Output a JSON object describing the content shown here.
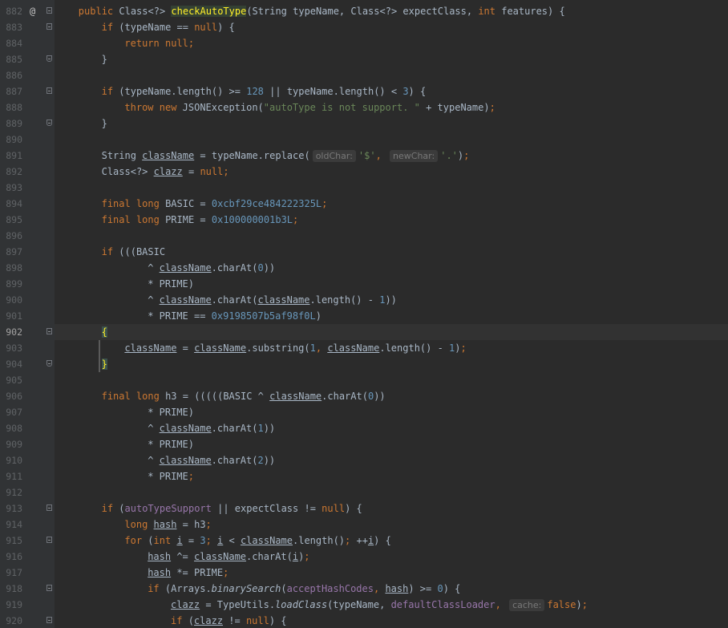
{
  "editor": {
    "current_line_number": "902",
    "lines": [
      {
        "n": "882",
        "icon": "@",
        "fold": "start",
        "indent": 1,
        "tokens": [
          {
            "t": "public ",
            "c": "kw"
          },
          {
            "t": "Class<?> "
          },
          {
            "t": "checkAutoType",
            "c": "hl-match"
          },
          {
            "t": "(String typeName, Class<?> expectClass, "
          },
          {
            "t": "int ",
            "c": "kw"
          },
          {
            "t": "features) {"
          }
        ]
      },
      {
        "n": "883",
        "fold": "start",
        "indent": 2,
        "tokens": [
          {
            "t": "if ",
            "c": "kw"
          },
          {
            "t": "(typeName == "
          },
          {
            "t": "null",
            "c": "kw"
          },
          {
            "t": ") {"
          }
        ]
      },
      {
        "n": "884",
        "indent": 3,
        "tokens": [
          {
            "t": "return null",
            "c": "kw"
          },
          {
            "t": ";",
            "c": "kw"
          }
        ]
      },
      {
        "n": "885",
        "fold": "end",
        "indent": 2,
        "tokens": [
          {
            "t": "}"
          }
        ]
      },
      {
        "n": "886",
        "indent": 0,
        "tokens": []
      },
      {
        "n": "887",
        "fold": "start",
        "indent": 2,
        "tokens": [
          {
            "t": "if ",
            "c": "kw"
          },
          {
            "t": "(typeName.length() >= "
          },
          {
            "t": "128",
            "c": "num"
          },
          {
            "t": " || typeName.length() < "
          },
          {
            "t": "3",
            "c": "num"
          },
          {
            "t": ") {"
          }
        ]
      },
      {
        "n": "888",
        "indent": 3,
        "tokens": [
          {
            "t": "throw new ",
            "c": "kw"
          },
          {
            "t": "JSONException("
          },
          {
            "t": "\"autoType is not support. \"",
            "c": "str"
          },
          {
            "t": " + typeName)"
          },
          {
            "t": ";",
            "c": "kw"
          }
        ]
      },
      {
        "n": "889",
        "fold": "end",
        "indent": 2,
        "tokens": [
          {
            "t": "}"
          }
        ]
      },
      {
        "n": "890",
        "indent": 0,
        "tokens": []
      },
      {
        "n": "891",
        "indent": 2,
        "tokens": [
          {
            "t": "String "
          },
          {
            "t": "className",
            "c": "ul"
          },
          {
            "t": " = typeName.replace("
          },
          {
            "t": "oldChar:",
            "c": "hint"
          },
          {
            "t": "'$'",
            "c": "str"
          },
          {
            "t": ", ",
            "c": "kw"
          },
          {
            "t": "newChar:",
            "c": "hint"
          },
          {
            "t": "'.'",
            "c": "str"
          },
          {
            "t": ")"
          },
          {
            "t": ";",
            "c": "kw"
          }
        ]
      },
      {
        "n": "892",
        "indent": 2,
        "tokens": [
          {
            "t": "Class<?> "
          },
          {
            "t": "clazz",
            "c": "ul"
          },
          {
            "t": " = "
          },
          {
            "t": "null",
            "c": "kw"
          },
          {
            "t": ";",
            "c": "kw"
          }
        ]
      },
      {
        "n": "893",
        "indent": 0,
        "tokens": []
      },
      {
        "n": "894",
        "indent": 2,
        "tokens": [
          {
            "t": "final long ",
            "c": "kw"
          },
          {
            "t": "BASIC = "
          },
          {
            "t": "0xcbf29ce484222325L",
            "c": "num"
          },
          {
            "t": ";",
            "c": "kw"
          }
        ]
      },
      {
        "n": "895",
        "indent": 2,
        "tokens": [
          {
            "t": "final long ",
            "c": "kw"
          },
          {
            "t": "PRIME = "
          },
          {
            "t": "0x100000001b3L",
            "c": "num"
          },
          {
            "t": ";",
            "c": "kw"
          }
        ]
      },
      {
        "n": "896",
        "indent": 0,
        "tokens": []
      },
      {
        "n": "897",
        "indent": 2,
        "tokens": [
          {
            "t": "if ",
            "c": "kw"
          },
          {
            "t": "(((BASIC"
          }
        ]
      },
      {
        "n": "898",
        "indent": 4,
        "tokens": [
          {
            "t": "^ "
          },
          {
            "t": "className",
            "c": "ul"
          },
          {
            "t": ".charAt("
          },
          {
            "t": "0",
            "c": "num"
          },
          {
            "t": "))"
          }
        ]
      },
      {
        "n": "899",
        "indent": 4,
        "tokens": [
          {
            "t": "* PRIME)"
          }
        ]
      },
      {
        "n": "900",
        "indent": 4,
        "tokens": [
          {
            "t": "^ "
          },
          {
            "t": "className",
            "c": "ul"
          },
          {
            "t": ".charAt("
          },
          {
            "t": "className",
            "c": "ul"
          },
          {
            "t": ".length() - "
          },
          {
            "t": "1",
            "c": "num"
          },
          {
            "t": "))"
          }
        ]
      },
      {
        "n": "901",
        "indent": 4,
        "tokens": [
          {
            "t": "* PRIME == "
          },
          {
            "t": "0x9198507b5af98f0L",
            "c": "num"
          },
          {
            "t": ")"
          }
        ]
      },
      {
        "n": "902",
        "fold": "start",
        "indent": 2,
        "current": true,
        "tokens": [
          {
            "t": "{",
            "c": "brace-hl"
          }
        ]
      },
      {
        "n": "903",
        "indent": 3,
        "tokens": [
          {
            "t": "className",
            "c": "ul"
          },
          {
            "t": " = "
          },
          {
            "t": "className",
            "c": "ul"
          },
          {
            "t": ".substring("
          },
          {
            "t": "1",
            "c": "num"
          },
          {
            "t": ", ",
            "c": "kw"
          },
          {
            "t": "className",
            "c": "ul"
          },
          {
            "t": ".length() - "
          },
          {
            "t": "1",
            "c": "num"
          },
          {
            "t": ")"
          },
          {
            "t": ";",
            "c": "kw"
          }
        ]
      },
      {
        "n": "904",
        "fold": "end",
        "indent": 2,
        "tokens": [
          {
            "t": "}",
            "c": "brace-hl"
          }
        ]
      },
      {
        "n": "905",
        "indent": 0,
        "tokens": []
      },
      {
        "n": "906",
        "indent": 2,
        "tokens": [
          {
            "t": "final long ",
            "c": "kw"
          },
          {
            "t": "h3 = (((((BASIC ^ "
          },
          {
            "t": "className",
            "c": "ul"
          },
          {
            "t": ".charAt("
          },
          {
            "t": "0",
            "c": "num"
          },
          {
            "t": "))"
          }
        ]
      },
      {
        "n": "907",
        "indent": 4,
        "tokens": [
          {
            "t": "* PRIME)"
          }
        ]
      },
      {
        "n": "908",
        "indent": 4,
        "tokens": [
          {
            "t": "^ "
          },
          {
            "t": "className",
            "c": "ul"
          },
          {
            "t": ".charAt("
          },
          {
            "t": "1",
            "c": "num"
          },
          {
            "t": "))"
          }
        ]
      },
      {
        "n": "909",
        "indent": 4,
        "tokens": [
          {
            "t": "* PRIME)"
          }
        ]
      },
      {
        "n": "910",
        "indent": 4,
        "tokens": [
          {
            "t": "^ "
          },
          {
            "t": "className",
            "c": "ul"
          },
          {
            "t": ".charAt("
          },
          {
            "t": "2",
            "c": "num"
          },
          {
            "t": "))"
          }
        ]
      },
      {
        "n": "911",
        "indent": 4,
        "tokens": [
          {
            "t": "* PRIME"
          },
          {
            "t": ";",
            "c": "kw"
          }
        ]
      },
      {
        "n": "912",
        "indent": 0,
        "tokens": []
      },
      {
        "n": "913",
        "fold": "start",
        "indent": 2,
        "tokens": [
          {
            "t": "if ",
            "c": "kw"
          },
          {
            "t": "("
          },
          {
            "t": "autoTypeSupport",
            "c": "fld"
          },
          {
            "t": " || expectClass != "
          },
          {
            "t": "null",
            "c": "kw"
          },
          {
            "t": ") {"
          }
        ]
      },
      {
        "n": "914",
        "indent": 3,
        "tokens": [
          {
            "t": "long ",
            "c": "kw"
          },
          {
            "t": "hash",
            "c": "ul"
          },
          {
            "t": " = h3"
          },
          {
            "t": ";",
            "c": "kw"
          }
        ]
      },
      {
        "n": "915",
        "fold": "start",
        "indent": 3,
        "tokens": [
          {
            "t": "for ",
            "c": "kw"
          },
          {
            "t": "("
          },
          {
            "t": "int ",
            "c": "kw"
          },
          {
            "t": "i",
            "c": "ul"
          },
          {
            "t": " = "
          },
          {
            "t": "3",
            "c": "num"
          },
          {
            "t": "; ",
            "c": "kw"
          },
          {
            "t": "i",
            "c": "ul"
          },
          {
            "t": " < "
          },
          {
            "t": "className",
            "c": "ul"
          },
          {
            "t": ".length()"
          },
          {
            "t": "; ",
            "c": "kw"
          },
          {
            "t": "++"
          },
          {
            "t": "i",
            "c": "ul"
          },
          {
            "t": ") {"
          }
        ]
      },
      {
        "n": "916",
        "indent": 4,
        "tokens": [
          {
            "t": "hash",
            "c": "ul"
          },
          {
            "t": " ^= "
          },
          {
            "t": "className",
            "c": "ul"
          },
          {
            "t": ".charAt("
          },
          {
            "t": "i",
            "c": "ul"
          },
          {
            "t": ")"
          },
          {
            "t": ";",
            "c": "kw"
          }
        ]
      },
      {
        "n": "917",
        "indent": 4,
        "tokens": [
          {
            "t": "hash",
            "c": "ul"
          },
          {
            "t": " *= PRIME"
          },
          {
            "t": ";",
            "c": "kw"
          }
        ]
      },
      {
        "n": "918",
        "fold": "start",
        "indent": 4,
        "tokens": [
          {
            "t": "if ",
            "c": "kw"
          },
          {
            "t": "(Arrays."
          },
          {
            "t": "binarySearch",
            "c": "it"
          },
          {
            "t": "("
          },
          {
            "t": "acceptHashCodes",
            "c": "fld"
          },
          {
            "t": ", ",
            "c": "kw"
          },
          {
            "t": "hash",
            "c": "ul"
          },
          {
            "t": ") >= "
          },
          {
            "t": "0",
            "c": "num"
          },
          {
            "t": ") {"
          }
        ]
      },
      {
        "n": "919",
        "indent": 5,
        "tokens": [
          {
            "t": "clazz",
            "c": "ul"
          },
          {
            "t": " = TypeUtils."
          },
          {
            "t": "loadClass",
            "c": "it"
          },
          {
            "t": "(typeName, "
          },
          {
            "t": "defaultClassLoader",
            "c": "fld"
          },
          {
            "t": ", ",
            "c": "kw"
          },
          {
            "t": "cache:",
            "c": "hint"
          },
          {
            "t": "false",
            "c": "kw"
          },
          {
            "t": ")"
          },
          {
            "t": ";",
            "c": "kw"
          }
        ]
      },
      {
        "n": "920",
        "fold": "start",
        "indent": 5,
        "tokens": [
          {
            "t": "if ",
            "c": "kw"
          },
          {
            "t": "("
          },
          {
            "t": "clazz",
            "c": "ul"
          },
          {
            "t": " != "
          },
          {
            "t": "null",
            "c": "kw"
          },
          {
            "t": ") {"
          }
        ]
      }
    ]
  }
}
